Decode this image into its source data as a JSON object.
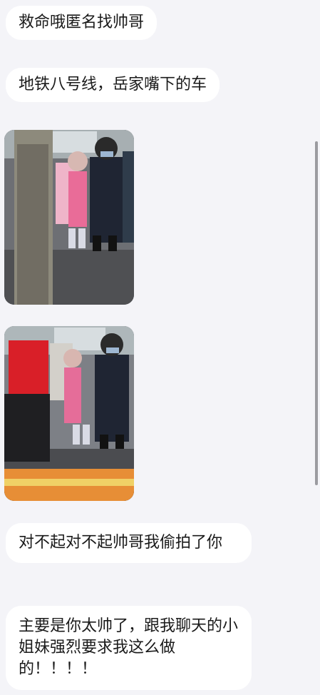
{
  "messages": [
    {
      "text": "救命哦匿名找帅哥"
    },
    {
      "text": "地铁八号线，岳家嘴下的车"
    },
    {
      "type": "photo",
      "icon": "subway-photo-1"
    },
    {
      "type": "photo",
      "icon": "subway-photo-2"
    },
    {
      "text": "对不起对不起帅哥我偷拍了你"
    },
    {
      "text": "主要是你太帅了，跟我聊天的小姐妹强烈要求我这么做的！！！！"
    }
  ]
}
